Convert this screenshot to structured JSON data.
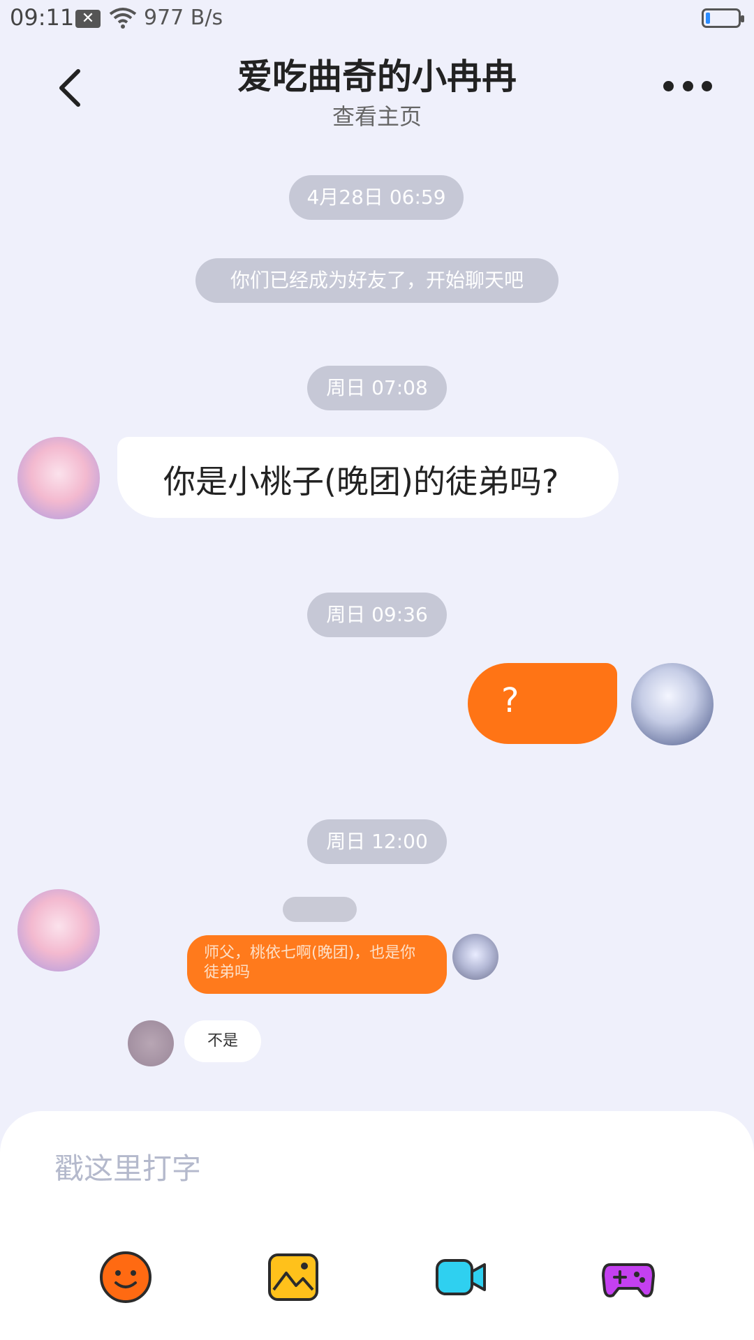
{
  "status_bar": {
    "time": "09:11",
    "speed": "977 B/s"
  },
  "header": {
    "title": "爱吃曲奇的小冉冉",
    "subtitle": "查看主页"
  },
  "messages": {
    "ts1": "4月28日 06:59",
    "system": "你们已经成为好友了，开始聊天吧",
    "ts2": "周日 07:08",
    "msg1": "你是小桃子(晚团)的徒弟吗?",
    "ts3": "周日 09:36",
    "msg2": "?",
    "ts4": "周日 12:00",
    "thumb_text": "师父，桃依七啊(晚团)，也是你徒弟吗",
    "thumb_reply": "不是"
  },
  "input": {
    "placeholder": "戳这里打字"
  },
  "tools": [
    "emoji-icon",
    "image-icon",
    "video-icon",
    "game-icon"
  ]
}
